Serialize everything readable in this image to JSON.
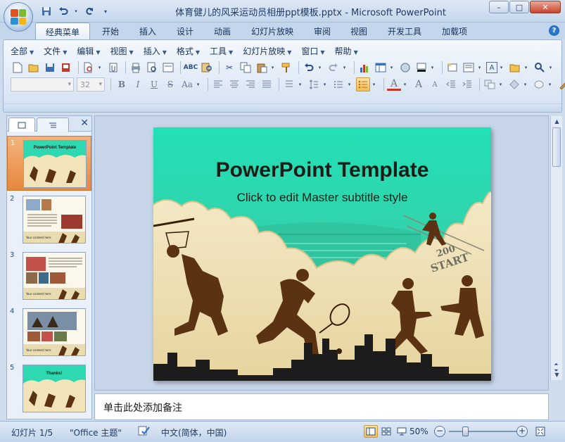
{
  "window": {
    "title": "体育健儿的风采运动员相册ppt模板.pptx - Microsoft PowerPoint",
    "controls": [
      "–",
      "□",
      "✕"
    ]
  },
  "quick_access": [
    "save-icon",
    "undo-icon",
    "redo-icon",
    "customize-icon"
  ],
  "ribbon": {
    "tabs": [
      "经典菜单",
      "开始",
      "插入",
      "设计",
      "动画",
      "幻灯片放映",
      "审阅",
      "视图",
      "开发工具",
      "加载项"
    ],
    "active_tab": "经典菜单",
    "menus": [
      "全部",
      "文件",
      "编辑",
      "视图",
      "插入",
      "格式",
      "工具",
      "幻灯片放映",
      "窗口",
      "帮助"
    ],
    "font_name": "",
    "font_size": "32",
    "format_buttons": [
      "B",
      "I",
      "U",
      "S",
      "Aa"
    ],
    "font_grow": "A",
    "font_shrink": "A"
  },
  "thumbnails": {
    "pane_close": "✕",
    "slides": [
      {
        "number": "1",
        "selected": true,
        "title": "PowerPoint Template"
      },
      {
        "number": "2",
        "selected": false,
        "title": "Your content here"
      },
      {
        "number": "3",
        "selected": false,
        "title": "Your content here"
      },
      {
        "number": "4",
        "selected": false,
        "title": "Your content here"
      },
      {
        "number": "5",
        "selected": false,
        "title": "Thanks!"
      }
    ]
  },
  "slide": {
    "title": "PowerPoint Template",
    "subtitle": "Click to edit Master subtitle style",
    "track_mark_1": "200",
    "track_mark_2": "START",
    "colors": {
      "sky": "#2ed8b0",
      "silhouette": "#5b3212",
      "paper": "#f2e4b8"
    }
  },
  "notes": {
    "placeholder": "单击此处添加备注"
  },
  "status": {
    "slide_counter": "幻灯片 1/5",
    "theme": "\"Office 主题\"",
    "language": "中文(简体，中国)",
    "zoom": "50%",
    "zoom_fraction": 0.5
  }
}
